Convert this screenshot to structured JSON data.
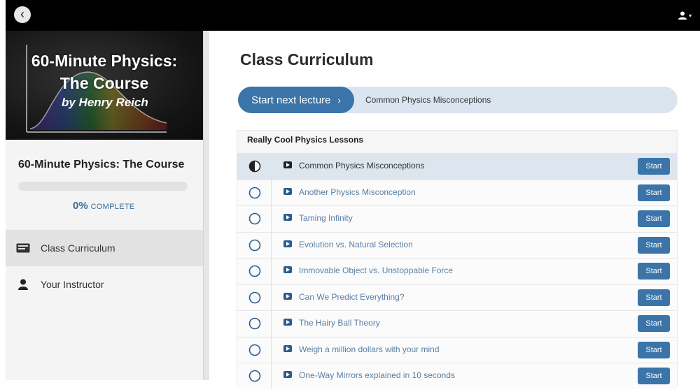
{
  "header": {
    "back_icon": "chevron-left-icon",
    "user_icon": "user-icon",
    "dropdown_icon": "caret-down-icon"
  },
  "sidebar": {
    "hero": {
      "title_line1": "60-Minute Physics:",
      "title_line2": "The Course",
      "author": "by Henry Reich"
    },
    "course_name": "60-Minute Physics: The Course",
    "progress": {
      "value": 0,
      "percent_text": "0%",
      "label": "COMPLETE"
    },
    "nav": [
      {
        "label": "Class Curriculum",
        "icon": "curriculum-icon",
        "active": true
      },
      {
        "label": "Your Instructor",
        "icon": "user-icon",
        "active": false
      }
    ]
  },
  "main": {
    "title": "Class Curriculum",
    "next_lecture": {
      "button_label": "Start next lecture",
      "chevron": "›",
      "lecture_title": "Common Physics Misconceptions"
    },
    "section": {
      "title": "Really Cool Physics Lessons",
      "lectures": [
        {
          "title": "Common Physics Misconceptions",
          "button": "Start",
          "status": "in-progress"
        },
        {
          "title": "Another Physics Misconception",
          "button": "Start",
          "status": "not-started"
        },
        {
          "title": "Taming Infinity",
          "button": "Start",
          "status": "not-started"
        },
        {
          "title": "Evolution vs. Natural Selection",
          "button": "Start",
          "status": "not-started"
        },
        {
          "title": "Immovable Object vs. Unstoppable Force",
          "button": "Start",
          "status": "not-started"
        },
        {
          "title": "Can We Predict Everything?",
          "button": "Start",
          "status": "not-started"
        },
        {
          "title": "The Hairy Ball Theory",
          "button": "Start",
          "status": "not-started"
        },
        {
          "title": "Weigh a million dollars with your mind",
          "button": "Start",
          "status": "not-started"
        },
        {
          "title": "One-Way Mirrors explained in 10 seconds",
          "button": "Start",
          "status": "not-started"
        }
      ]
    }
  },
  "colors": {
    "accent": "#3a74a9",
    "topbar": "#000000",
    "sidebar": "#f4f4f4",
    "current_row": "#dde6ee"
  }
}
